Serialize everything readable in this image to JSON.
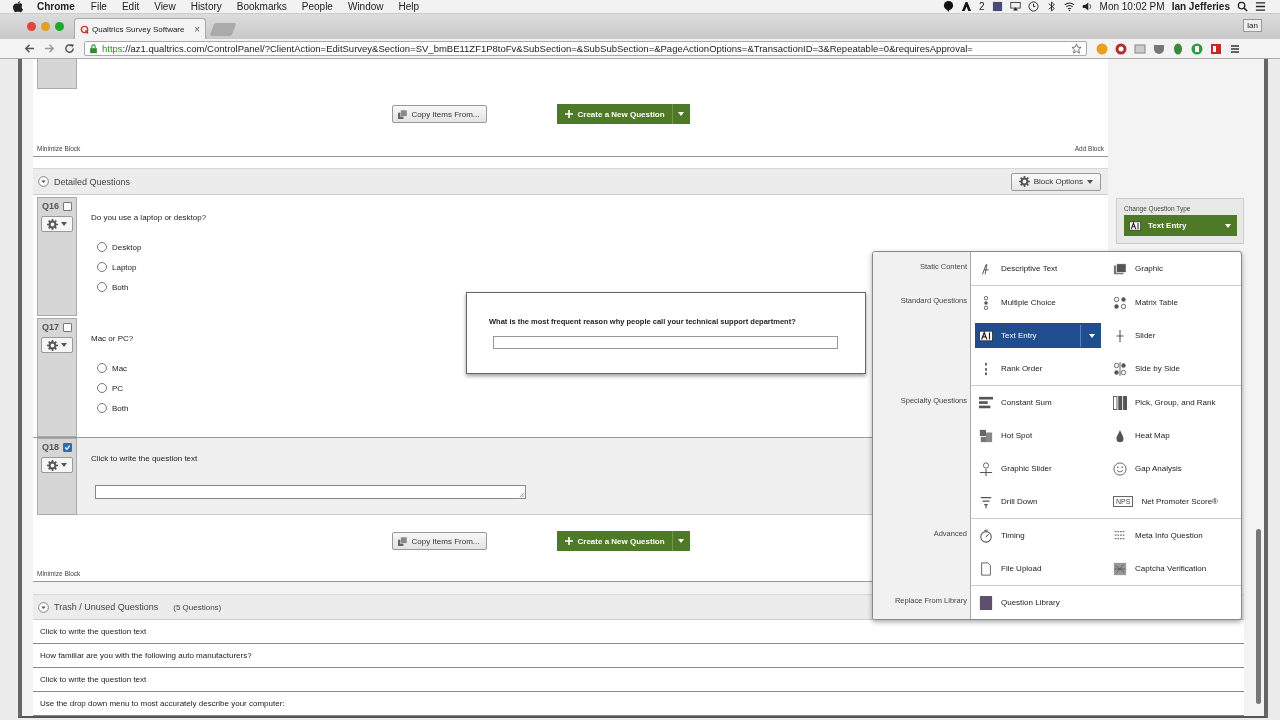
{
  "menubar": {
    "app": "Chrome",
    "menus": [
      "File",
      "Edit",
      "View",
      "History",
      "Bookmarks",
      "People",
      "Window",
      "Help"
    ],
    "adobe_count": "2",
    "clock": "Mon 10:02 PM",
    "user": "Ian Jefferies"
  },
  "browser": {
    "tab": {
      "title": "Qualtrics Survey Software",
      "close": "×"
    },
    "profile": "Ian",
    "url": {
      "scheme": "https",
      "rest": "://az1.qualtrics.com/ControlPanel/?ClientAction=EditSurvey&Section=SV_bmBE11ZF1P8toFv&SubSection=&SubSubSection=&PageActionOptions=&TransactionID=3&Repeatable=0&requiresApproval="
    }
  },
  "top_block": {
    "copy_button": "Copy Items From...",
    "create_button": "Create a New Question",
    "minimize": "Minimize Block",
    "add_block": "Add Block"
  },
  "detailed_block": {
    "title": "Detailed Questions",
    "block_options": "Block Options",
    "questions": [
      {
        "number": "Q16",
        "selected": false,
        "kind": "choice",
        "text": "Do you use a laptop or desktop?",
        "choices": [
          {
            "label": "Desktop",
            "selected": false
          },
          {
            "label": "Laptop",
            "selected": false
          },
          {
            "label": "Both",
            "selected": false
          }
        ]
      },
      {
        "number": "Q17",
        "selected": false,
        "kind": "choice",
        "text": "Mac or PC?",
        "choices": [
          {
            "label": "Mac",
            "selected": false
          },
          {
            "label": "PC",
            "selected": false
          },
          {
            "label": "Both",
            "selected": false
          }
        ]
      },
      {
        "number": "Q18",
        "selected": true,
        "kind": "text",
        "text": "Click to write the question text"
      }
    ],
    "copy_button": "Copy Items From...",
    "create_button": "Create a New Question",
    "minimize": "Minimize Block"
  },
  "trash_block": {
    "title": "Trash / Unused Questions",
    "count": "(5 Questions)",
    "questions": [
      "Click to write the question text",
      "How familiar are you with the following auto manufacturers?",
      "Click to write the question text",
      "Use the drop down menu to most accurately describe your computer:"
    ]
  },
  "question_type_panel": {
    "label": "Change Question Type",
    "value": "Text Entry"
  },
  "preview": {
    "question": "What is the most frequent reason why people call your technical support department?"
  },
  "type_menu": {
    "groups": [
      {
        "label": "Static Content",
        "items": [
          {
            "label": "Descriptive Text",
            "kind": "descriptive",
            "selected": false
          },
          {
            "label": "Graphic",
            "kind": "graphic",
            "selected": false
          }
        ]
      },
      {
        "label": "Standard Questions",
        "items": [
          {
            "label": "Multiple Choice",
            "kind": "choice",
            "selected": false
          },
          {
            "label": "Matrix Table",
            "kind": "matrix",
            "selected": false
          },
          {
            "label": "Text Entry",
            "kind": "textentry",
            "selected": true
          },
          {
            "label": "Slider",
            "kind": "slider",
            "selected": false
          },
          {
            "label": "Rank Order",
            "kind": "rank",
            "selected": false
          },
          {
            "label": "Side by Side",
            "kind": "sidebyside",
            "selected": false
          }
        ]
      },
      {
        "label": "Specialty Questions",
        "items": [
          {
            "label": "Constant Sum",
            "kind": "sum",
            "selected": false
          },
          {
            "label": "Pick, Group, and Rank",
            "kind": "pick",
            "selected": false
          },
          {
            "label": "Hot Spot",
            "kind": "hotspot",
            "selected": false
          },
          {
            "label": "Heat Map",
            "kind": "heatmap",
            "selected": false
          },
          {
            "label": "Graphic Slider",
            "kind": "graphicslider",
            "selected": false
          },
          {
            "label": "Gap Analysis",
            "kind": "gap",
            "selected": false
          },
          {
            "label": "Drill Down",
            "kind": "drilldown",
            "selected": false
          },
          {
            "label": "Net Promoter Score®",
            "kind": "nps",
            "badge": "NPS",
            "selected": false
          }
        ]
      },
      {
        "label": "Advanced",
        "items": [
          {
            "label": "Timing",
            "kind": "timing",
            "selected": false
          },
          {
            "label": "Meta Info Question",
            "kind": "meta",
            "selected": false
          },
          {
            "label": "File Upload",
            "kind": "upload",
            "selected": false
          },
          {
            "label": "Captcha Verification",
            "kind": "captcha",
            "selected": false
          }
        ]
      },
      {
        "label": "Replace From Library",
        "items": [
          {
            "label": "Question Library",
            "kind": "library",
            "selected": false
          }
        ]
      }
    ]
  }
}
